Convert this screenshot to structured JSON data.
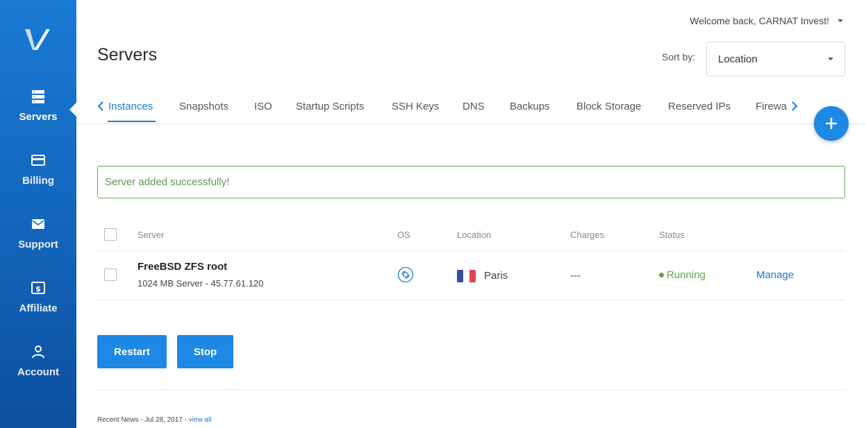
{
  "sidebar": {
    "items": [
      {
        "label": "Servers",
        "icon": "servers-icon"
      },
      {
        "label": "Billing",
        "icon": "card-icon"
      },
      {
        "label": "Support",
        "icon": "envelope-icon"
      },
      {
        "label": "Affiliate",
        "icon": "dollar-icon"
      },
      {
        "label": "Account",
        "icon": "user-icon"
      }
    ],
    "active": "Servers"
  },
  "header": {
    "welcome": "Welcome back, CARNAT Invest!",
    "title": "Servers",
    "sort_label": "Sort by:",
    "sort_value": "Location"
  },
  "tabs": {
    "items": [
      "Instances",
      "Snapshots",
      "ISO",
      "Startup Scripts",
      "SSH Keys",
      "DNS",
      "Backups",
      "Block Storage",
      "Reserved IPs",
      "Firewa"
    ],
    "active": "Instances"
  },
  "alert": {
    "message": "Server added successfully!"
  },
  "table": {
    "headers": {
      "server": "Server",
      "os": "OS",
      "location": "Location",
      "charges": "Charges",
      "status": "Status"
    },
    "rows": [
      {
        "name": "FreeBSD ZFS root",
        "details": "1024 MB Server - 45.77.61.120",
        "os_icon": "disc-icon",
        "location": "Paris",
        "flag": "france-flag",
        "charges": "---",
        "status": "Running",
        "action": "Manage"
      }
    ]
  },
  "actions": {
    "restart": "Restart",
    "stop": "Stop"
  },
  "news": {
    "text": "Recent News - Jul 28, 2017 - ",
    "link": "view all"
  },
  "colors": {
    "accent": "#1e88e5",
    "sidebar": "#1262b8",
    "success": "#5aaa47",
    "flag_blue": "#3b4da0",
    "flag_white": "#ffffff",
    "flag_red": "#e8434a"
  }
}
